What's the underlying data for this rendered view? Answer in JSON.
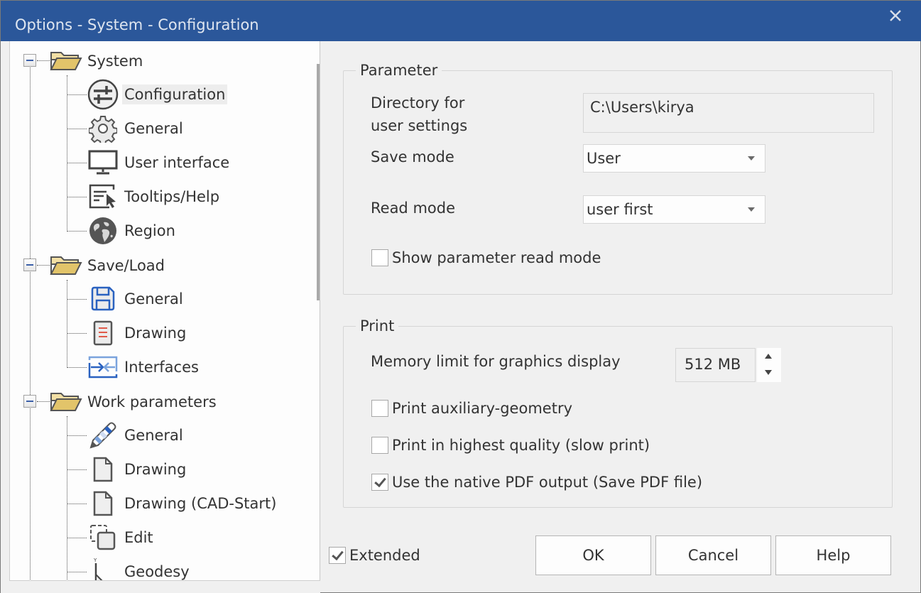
{
  "window": {
    "title": "Options - System - Configuration",
    "close_icon": "close-icon"
  },
  "tree": {
    "groups": [
      {
        "label": "System",
        "icon": "folder-open-icon",
        "expanded": true,
        "children": [
          {
            "label": "Configuration",
            "icon": "sliders-icon",
            "selected": true
          },
          {
            "label": "General",
            "icon": "gear-icon"
          },
          {
            "label": "User interface",
            "icon": "monitor-icon"
          },
          {
            "label": "Tooltips/Help",
            "icon": "tooltip-cursor-icon"
          },
          {
            "label": "Region",
            "icon": "globe-icon"
          }
        ]
      },
      {
        "label": "Save/Load",
        "icon": "folder-open-icon",
        "expanded": true,
        "children": [
          {
            "label": "General",
            "icon": "floppy-disk-icon"
          },
          {
            "label": "Drawing",
            "icon": "drawing-document-icon"
          },
          {
            "label": "Interfaces",
            "icon": "import-arrow-icon"
          }
        ]
      },
      {
        "label": "Work parameters",
        "icon": "folder-open-icon",
        "expanded": true,
        "children": [
          {
            "label": "General",
            "icon": "pencil-icon"
          },
          {
            "label": "Drawing",
            "icon": "blank-page-icon"
          },
          {
            "label": "Drawing (CAD-Start)",
            "icon": "blank-page-icon"
          },
          {
            "label": "Edit",
            "icon": "edit-selection-icon"
          },
          {
            "label": "Geodesy",
            "icon": "geodesy-axes-icon"
          }
        ]
      }
    ]
  },
  "parameter": {
    "title": "Parameter",
    "directory_label_line1": "Directory for",
    "directory_label_line2": "user settings",
    "directory_value": "C:\\Users\\kirya",
    "save_mode_label": "Save mode",
    "save_mode_value": "User",
    "read_mode_label": "Read mode",
    "read_mode_value": "user first",
    "show_read_mode_label": "Show parameter read mode",
    "show_read_mode_checked": false
  },
  "print": {
    "title": "Print",
    "memory_label": "Memory limit for graphics display",
    "memory_value": "512 MB",
    "aux_geometry_label": "Print auxiliary-geometry",
    "aux_geometry_checked": false,
    "highest_quality_label": "Print in highest quality (slow print)",
    "highest_quality_checked": false,
    "native_pdf_label": "Use the native PDF output (Save PDF file)",
    "native_pdf_checked": true
  },
  "footer": {
    "extended_label": "Extended",
    "extended_checked": true,
    "ok_label": "OK",
    "cancel_label": "Cancel",
    "help_label": "Help"
  },
  "colors": {
    "titlebar": "#2b579a",
    "folder": "#e2c46a",
    "accent_blue": "#2a62c0",
    "drawing_red": "#e05a4a"
  }
}
